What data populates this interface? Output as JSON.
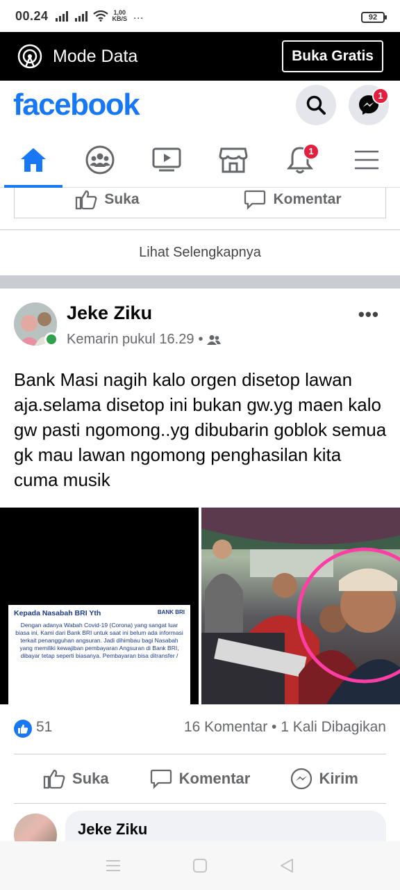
{
  "status_bar": {
    "time": "00.24",
    "net_speed_value": "1,00",
    "net_speed_unit": "KB/S",
    "more": "…",
    "battery": "92"
  },
  "mode_bar": {
    "label": "Mode Data",
    "button": "Buka Gratis"
  },
  "header": {
    "logo": "facebook",
    "messenger_badge": "1"
  },
  "nav": {
    "tabs": [
      "home",
      "groups",
      "watch",
      "marketplace",
      "notifications",
      "menu"
    ],
    "notifications_badge": "1"
  },
  "previous_post": {
    "like_label": "Suka",
    "comment_label": "Komentar",
    "see_more": "Lihat Selengkapnya"
  },
  "post": {
    "author": "Jeke Ziku",
    "time": "Kemarin pukul 16.29",
    "separator_dot": "•",
    "text": "Bank Masi nagih kalo orgen disetop lawan aja.selama disetop ini bukan gw.yg maen kalo gw pasti ngomong..yg dibubarin goblok semua gk mau lawan ngomong penghasilan kita cuma musik",
    "notice": {
      "logo": "BANK BRI",
      "title": "Kepada Nasabah BRI Yth",
      "body": "Dengan adanya Wabah Covid-19 (Corona) yang sangat luar biasa ini, Kami dari Bank BRI untuk saat ini belum ada informasi terkait penangguhan angsuran. Jadi dihimbau bagi Nasabah yang memiliki kewajiban pembayaran Angsuran di Bank BRI, dibayar tetap seperti biasanya. Pembayaran bisa ditransfer /"
    },
    "likes": "51",
    "stats": "16 Komentar • 1 Kali Dibagikan",
    "actions": {
      "like": "Suka",
      "comment": "Komentar",
      "send": "Kirim"
    },
    "comment_author": "Jeke Ziku"
  },
  "colors": {
    "brand": "#1877f2",
    "badge": "#e41e3f",
    "online": "#31a24c",
    "highlight_circle": "#ff3ea5"
  }
}
